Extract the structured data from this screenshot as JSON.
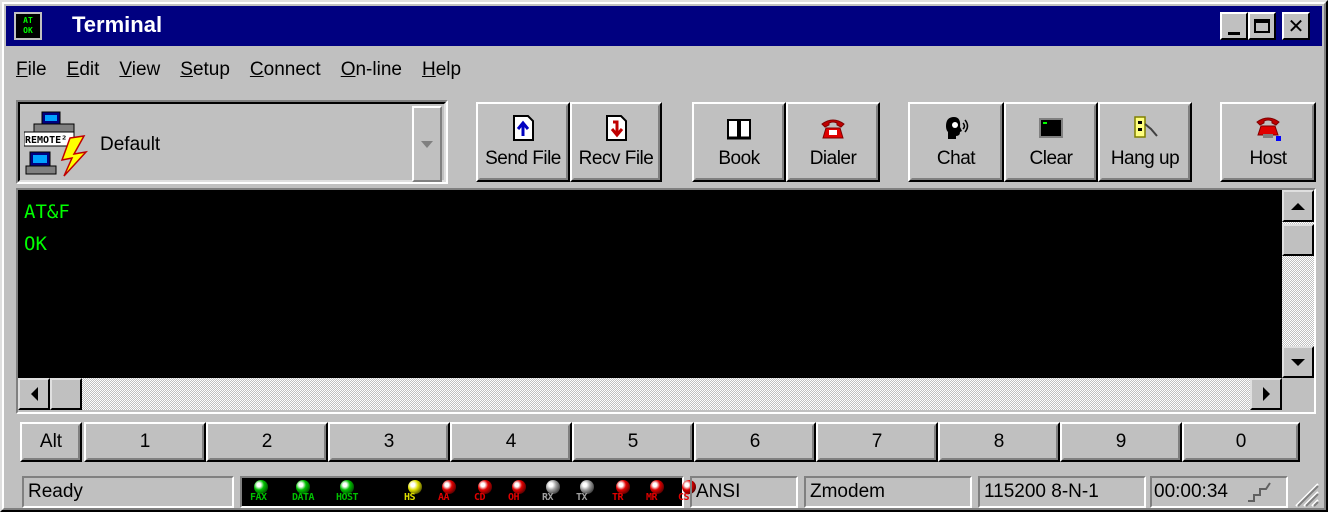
{
  "window": {
    "title": "Terminal",
    "icon_text": "AT\nOK"
  },
  "menu": [
    {
      "pre": "",
      "u": "F",
      "post": "ile"
    },
    {
      "pre": "",
      "u": "E",
      "post": "dit"
    },
    {
      "pre": "",
      "u": "V",
      "post": "iew"
    },
    {
      "pre": "",
      "u": "S",
      "post": "etup"
    },
    {
      "pre": "",
      "u": "C",
      "post": "onnect"
    },
    {
      "pre": "",
      "u": "O",
      "post": "n-line"
    },
    {
      "pre": "",
      "u": "H",
      "post": "elp"
    }
  ],
  "profile": {
    "label": "Default",
    "icon_text": "REMOTE²"
  },
  "toolbar": {
    "send_file": "Send File",
    "recv_file": "Recv File",
    "book": "Book",
    "dialer": "Dialer",
    "chat": "Chat",
    "clear": "Clear",
    "hang_up": "Hang up",
    "host": "Host"
  },
  "terminal": {
    "lines": [
      "AT&F",
      "OK"
    ],
    "text_color": "#00ff00",
    "bg_color": "#000000"
  },
  "fkeys": [
    "Alt",
    "1",
    "2",
    "3",
    "4",
    "5",
    "6",
    "7",
    "8",
    "9",
    "0"
  ],
  "status": {
    "state": "Ready",
    "emulation": "ANSI",
    "protocol": "Zmodem",
    "port_settings": "115200 8-N-1",
    "timer": "00:00:34"
  },
  "leds": [
    {
      "label": "FAX",
      "color": "#00c000"
    },
    {
      "label": "DATA",
      "color": "#00c000"
    },
    {
      "label": "HOST",
      "color": "#00c000"
    },
    {
      "label": "HS",
      "color": "#e0e000"
    },
    {
      "label": "AA",
      "color": "#e00000"
    },
    {
      "label": "CD",
      "color": "#e00000"
    },
    {
      "label": "OH",
      "color": "#e00000"
    },
    {
      "label": "RX",
      "color": "#a0a0a0"
    },
    {
      "label": "TX",
      "color": "#a0a0a0"
    },
    {
      "label": "TR",
      "color": "#e00000"
    },
    {
      "label": "MR",
      "color": "#e00000"
    },
    {
      "label": "CS",
      "color": "#e00000"
    }
  ],
  "colors": {
    "titlebar": "#000080",
    "face": "#c0c0c0",
    "terminal_text": "#00ff00"
  }
}
